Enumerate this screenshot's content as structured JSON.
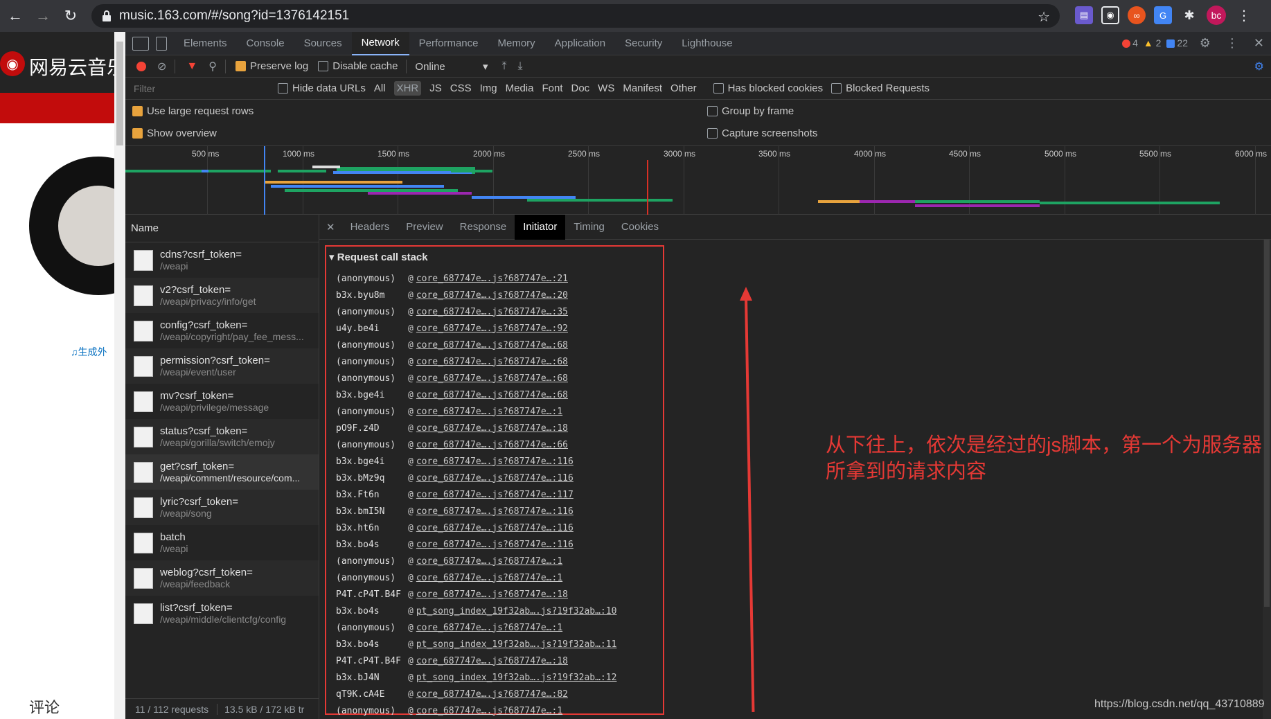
{
  "browser": {
    "url": "music.163.com/#/song?id=1376142151",
    "profile_initials": "bc"
  },
  "site": {
    "name": "网易云音乐",
    "gen_link": "生成外",
    "comment_label": "评论"
  },
  "devtools": {
    "tabs": [
      "Elements",
      "Console",
      "Sources",
      "Network",
      "Performance",
      "Memory",
      "Application",
      "Security",
      "Lighthouse"
    ],
    "active_tab": "Network",
    "errors": "4",
    "warnings": "2",
    "messages": "22",
    "toolbar": {
      "preserve_log": "Preserve log",
      "disable_cache": "Disable cache",
      "throttle": "Online"
    },
    "filter": {
      "placeholder": "Filter",
      "hide_data_urls": "Hide data URLs",
      "types": [
        "All",
        "XHR",
        "JS",
        "CSS",
        "Img",
        "Media",
        "Font",
        "Doc",
        "WS",
        "Manifest",
        "Other"
      ],
      "active_type": "XHR",
      "has_blocked_cookies": "Has blocked cookies",
      "blocked_requests": "Blocked Requests"
    },
    "options": {
      "large_rows": "Use large request rows",
      "show_overview": "Show overview",
      "group_by_frame": "Group by frame",
      "capture_screenshots": "Capture screenshots"
    },
    "overview_ticks": [
      "500 ms",
      "1000 ms",
      "1500 ms",
      "2000 ms",
      "2500 ms",
      "3000 ms",
      "3500 ms",
      "4000 ms",
      "4500 ms",
      "5000 ms",
      "5500 ms",
      "6000 ms"
    ],
    "requests_header": "Name",
    "requests": [
      {
        "name": "cdns?csrf_token=",
        "path": "/weapi"
      },
      {
        "name": "v2?csrf_token=",
        "path": "/weapi/privacy/info/get"
      },
      {
        "name": "config?csrf_token=",
        "path": "/weapi/copyright/pay_fee_mess..."
      },
      {
        "name": "permission?csrf_token=",
        "path": "/weapi/event/user"
      },
      {
        "name": "mv?csrf_token=",
        "path": "/weapi/privilege/message"
      },
      {
        "name": "status?csrf_token=",
        "path": "/weapi/gorilla/switch/emojy"
      },
      {
        "name": "get?csrf_token=",
        "path": "/weapi/comment/resource/com..."
      },
      {
        "name": "lyric?csrf_token=",
        "path": "/weapi/song"
      },
      {
        "name": "batch",
        "path": "/weapi"
      },
      {
        "name": "weblog?csrf_token=",
        "path": "/weapi/feedback"
      },
      {
        "name": "list?csrf_token=",
        "path": "/weapi/middle/clientcfg/config"
      }
    ],
    "footer_requests": "11 / 112 requests",
    "footer_size": "13.5 kB / 172 kB tr",
    "detail_tabs": [
      "Headers",
      "Preview",
      "Response",
      "Initiator",
      "Timing",
      "Cookies"
    ],
    "detail_active": "Initiator",
    "stack_title": "Request call stack",
    "frames": [
      {
        "fn": "(anonymous)",
        "link": "core_687747e….js?687747e…:21"
      },
      {
        "fn": "b3x.byu8m",
        "link": "core_687747e….js?687747e…:20"
      },
      {
        "fn": "(anonymous)",
        "link": "core_687747e….js?687747e…:35"
      },
      {
        "fn": "u4y.be4i",
        "link": "core_687747e….js?687747e…:92"
      },
      {
        "fn": "(anonymous)",
        "link": "core_687747e….js?687747e…:68"
      },
      {
        "fn": "(anonymous)",
        "link": "core_687747e….js?687747e…:68"
      },
      {
        "fn": "(anonymous)",
        "link": "core_687747e….js?687747e…:68"
      },
      {
        "fn": "b3x.bge4i",
        "link": "core_687747e….js?687747e…:68"
      },
      {
        "fn": "(anonymous)",
        "link": "core_687747e….js?687747e…:1"
      },
      {
        "fn": "pO9F.z4D",
        "link": "core_687747e….js?687747e…:18"
      },
      {
        "fn": "(anonymous)",
        "link": "core_687747e….js?687747e…:66"
      },
      {
        "fn": "b3x.bge4i",
        "link": "core_687747e….js?687747e…:116"
      },
      {
        "fn": "b3x.bMz9q",
        "link": "core_687747e….js?687747e…:116"
      },
      {
        "fn": "b3x.Ft6n",
        "link": "core_687747e….js?687747e…:117"
      },
      {
        "fn": "b3x.bmI5N",
        "link": "core_687747e….js?687747e…:116"
      },
      {
        "fn": "b3x.ht6n",
        "link": "core_687747e….js?687747e…:116"
      },
      {
        "fn": "b3x.bo4s",
        "link": "core_687747e….js?687747e…:116"
      },
      {
        "fn": "(anonymous)",
        "link": "core_687747e….js?687747e…:1"
      },
      {
        "fn": "(anonymous)",
        "link": "core_687747e….js?687747e…:1"
      },
      {
        "fn": "P4T.cP4T.B4F",
        "link": "core_687747e….js?687747e…:18"
      },
      {
        "fn": "b3x.bo4s",
        "link": "pt_song_index_19f32ab….js?19f32ab…:10"
      },
      {
        "fn": "(anonymous)",
        "link": "core_687747e….js?687747e…:1"
      },
      {
        "fn": "b3x.bo4s",
        "link": "pt_song_index_19f32ab….js?19f32ab…:11"
      },
      {
        "fn": "P4T.cP4T.B4F",
        "link": "core_687747e….js?687747e…:18"
      },
      {
        "fn": "b3x.bJ4N",
        "link": "pt_song_index_19f32ab….js?19f32ab…:12"
      },
      {
        "fn": "qT9K.cA4E",
        "link": "core_687747e….js?687747e…:82"
      },
      {
        "fn": "(anonymous)",
        "link": "core_687747e….js?687747e…:1"
      }
    ]
  },
  "annotation": {
    "note": "从下往上，依次是经过的js脚本，第一个为服务器所拿到的请求内容",
    "watermark": "https://blog.csdn.net/qq_43710889"
  }
}
